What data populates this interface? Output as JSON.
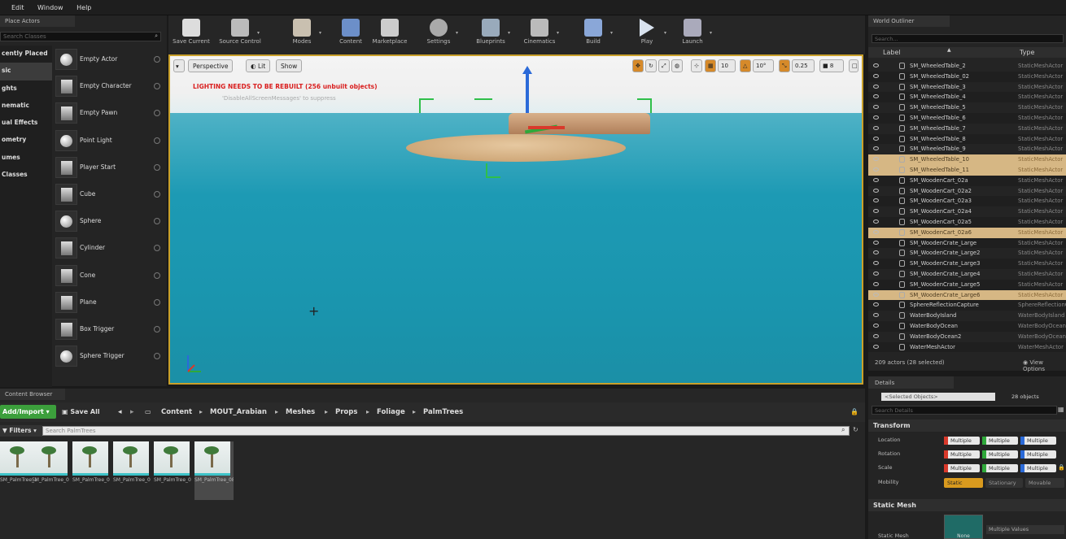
{
  "menubar": {
    "items": [
      "Edit",
      "Window",
      "Help"
    ]
  },
  "place_actors": {
    "tab": "Place Actors",
    "search_placeholder": "Search Classes",
    "categories": [
      "Recently Placed",
      "Basic",
      "Lights",
      "Cinematic",
      "Visual Effects",
      "Geometry",
      "Volumes",
      "All Classes"
    ],
    "categories_visible": [
      "cently Placed",
      "sic",
      "ghts",
      "nematic",
      "ual Effects",
      "ometry",
      "umes",
      "Classes"
    ],
    "items": [
      "Empty Actor",
      "Empty Character",
      "Empty Pawn",
      "Point Light",
      "Player Start",
      "Cube",
      "Sphere",
      "Cylinder",
      "Cone",
      "Plane",
      "Box Trigger",
      "Sphere Trigger"
    ]
  },
  "toolbar": {
    "buttons": [
      "Save Current",
      "Source Control",
      "Modes",
      "Content",
      "Marketplace",
      "Settings",
      "Blueprints",
      "Cinematics",
      "Build",
      "Play",
      "Launch"
    ]
  },
  "viewport": {
    "perspective": "Perspective",
    "lit": "Lit",
    "show": "Show",
    "warning": "LIGHTING NEEDS TO BE REBUILT (256 unbuilt objects)",
    "warning_hint": "'DisableAllScreenMessages' to suppress",
    "grid_snap": "10",
    "rot_snap": "10°",
    "scale_snap": "0.25",
    "cam_speed": "8"
  },
  "outliner": {
    "tab": "World Outliner",
    "search_placeholder": "Search...",
    "col_label": "Label",
    "col_type": "Type",
    "rows": [
      {
        "name": "SM_WheeledTable_2",
        "type": "StaticMeshActor",
        "sel": false
      },
      {
        "name": "SM_WheeledTable_02",
        "type": "StaticMeshActor",
        "sel": false
      },
      {
        "name": "SM_WheeledTable_3",
        "type": "StaticMeshActor",
        "sel": false
      },
      {
        "name": "SM_WheeledTable_4",
        "type": "StaticMeshActor",
        "sel": false
      },
      {
        "name": "SM_WheeledTable_5",
        "type": "StaticMeshActor",
        "sel": false
      },
      {
        "name": "SM_WheeledTable_6",
        "type": "StaticMeshActor",
        "sel": false
      },
      {
        "name": "SM_WheeledTable_7",
        "type": "StaticMeshActor",
        "sel": false
      },
      {
        "name": "SM_WheeledTable_8",
        "type": "StaticMeshActor",
        "sel": false
      },
      {
        "name": "SM_WheeledTable_9",
        "type": "StaticMeshActor",
        "sel": false
      },
      {
        "name": "SM_WheeledTable_10",
        "type": "StaticMeshActor",
        "sel": true
      },
      {
        "name": "SM_WheeledTable_11",
        "type": "StaticMeshActor",
        "sel": true
      },
      {
        "name": "SM_WoodenCart_02a",
        "type": "StaticMeshActor",
        "sel": false
      },
      {
        "name": "SM_WoodenCart_02a2",
        "type": "StaticMeshActor",
        "sel": false
      },
      {
        "name": "SM_WoodenCart_02a3",
        "type": "StaticMeshActor",
        "sel": false
      },
      {
        "name": "SM_WoodenCart_02a4",
        "type": "StaticMeshActor",
        "sel": false
      },
      {
        "name": "SM_WoodenCart_02a5",
        "type": "StaticMeshActor",
        "sel": false
      },
      {
        "name": "SM_WoodenCart_02a6",
        "type": "StaticMeshActor",
        "sel": true
      },
      {
        "name": "SM_WoodenCrate_Large",
        "type": "StaticMeshActor",
        "sel": false
      },
      {
        "name": "SM_WoodenCrate_Large2",
        "type": "StaticMeshActor",
        "sel": false
      },
      {
        "name": "SM_WoodenCrate_Large3",
        "type": "StaticMeshActor",
        "sel": false
      },
      {
        "name": "SM_WoodenCrate_Large4",
        "type": "StaticMeshActor",
        "sel": false
      },
      {
        "name": "SM_WoodenCrate_Large5",
        "type": "StaticMeshActor",
        "sel": false
      },
      {
        "name": "SM_WoodenCrate_Large6",
        "type": "StaticMeshActor",
        "sel": true
      },
      {
        "name": "SphereReflectionCapture",
        "type": "SphereReflectionCapture",
        "sel": false
      },
      {
        "name": "WaterBodyIsland",
        "type": "WaterBodyIsland",
        "sel": false
      },
      {
        "name": "WaterBodyOcean",
        "type": "WaterBodyOcean",
        "sel": false
      },
      {
        "name": "WaterBodyOcean2",
        "type": "WaterBodyOcean",
        "sel": false
      },
      {
        "name": "WaterMeshActor",
        "type": "WaterMeshActor",
        "sel": false
      }
    ],
    "footer": "209 actors (28 selected)",
    "view_options": "View Options"
  },
  "details": {
    "tab": "Details",
    "selected": "<Selected Objects>",
    "count": "28 objects",
    "search_placeholder": "Search Details",
    "transform": "Transform",
    "location": "Location",
    "rotation": "Rotation",
    "scale": "Scale",
    "mobility": "Mobility",
    "multiple": "Multiple",
    "mobility_static1": "Static",
    "mobility_static2": "Stationary",
    "mobility_movable": "Movable",
    "static_mesh_section": "Static Mesh",
    "static_mesh": "Static Mesh",
    "static_mesh_value": "Multiple Values",
    "none": "None"
  },
  "content_browser": {
    "tab": "Content Browser",
    "add_import": "Add/Import",
    "save_all": "Save All",
    "path": [
      "Content",
      "MOUT_Arabian",
      "Meshes",
      "Props",
      "Foliage",
      "PalmTrees"
    ],
    "filters": "Filters",
    "search_placeholder": "Search PalmTrees",
    "assets": [
      "SM_PalmTree_10",
      "SM_PalmTree_02",
      "SM_PalmTree_04",
      "SM_PalmTree_05",
      "SM_PalmTree_07",
      "SM_PalmTree_08"
    ]
  }
}
